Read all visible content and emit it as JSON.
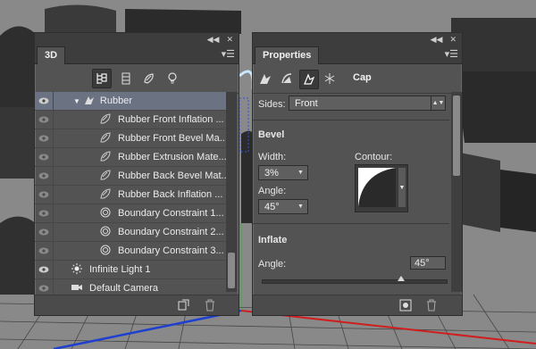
{
  "panel_3d": {
    "tab": "3D",
    "filter_tools": [
      "whole-scene-icon",
      "meshes-icon",
      "materials-icon",
      "lights-icon"
    ],
    "layers": [
      {
        "label": "Rubber",
        "type": "mesh",
        "selected": true,
        "visible": true
      },
      {
        "label": "Rubber Front Inflation ...",
        "type": "material",
        "visible": false
      },
      {
        "label": "Rubber Front Bevel Ma...",
        "type": "material",
        "visible": false
      },
      {
        "label": "Rubber Extrusion Mate...",
        "type": "material",
        "visible": false
      },
      {
        "label": "Rubber Back Bevel Mat...",
        "type": "material",
        "visible": false
      },
      {
        "label": "Rubber Back Inflation ...",
        "type": "material",
        "visible": false
      },
      {
        "label": "Boundary Constraint 1...",
        "type": "constraint",
        "visible": false
      },
      {
        "label": "Boundary Constraint 2...",
        "type": "constraint",
        "visible": false
      },
      {
        "label": "Boundary Constraint 3...",
        "type": "constraint",
        "visible": false
      },
      {
        "label": "Infinite Light 1",
        "type": "light",
        "visible": true
      },
      {
        "label": "Default Camera",
        "type": "camera",
        "visible": false
      }
    ]
  },
  "properties": {
    "tab": "Properties",
    "section": "Cap",
    "sides_label": "Sides:",
    "sides_value": "Front",
    "bevel_title": "Bevel",
    "width_label": "Width:",
    "width_value": "3%",
    "contour_label": "Contour:",
    "angle_label": "Angle:",
    "angle_value": "45°",
    "inflate_title": "Inflate",
    "inflate_angle_label": "Angle:",
    "inflate_angle_value": "45°",
    "inflate_angle_slider": 0.75
  },
  "colors": {
    "panel_bg": "#535353",
    "selection": "#6b7383",
    "tab_bar": "#3d3d3d"
  }
}
